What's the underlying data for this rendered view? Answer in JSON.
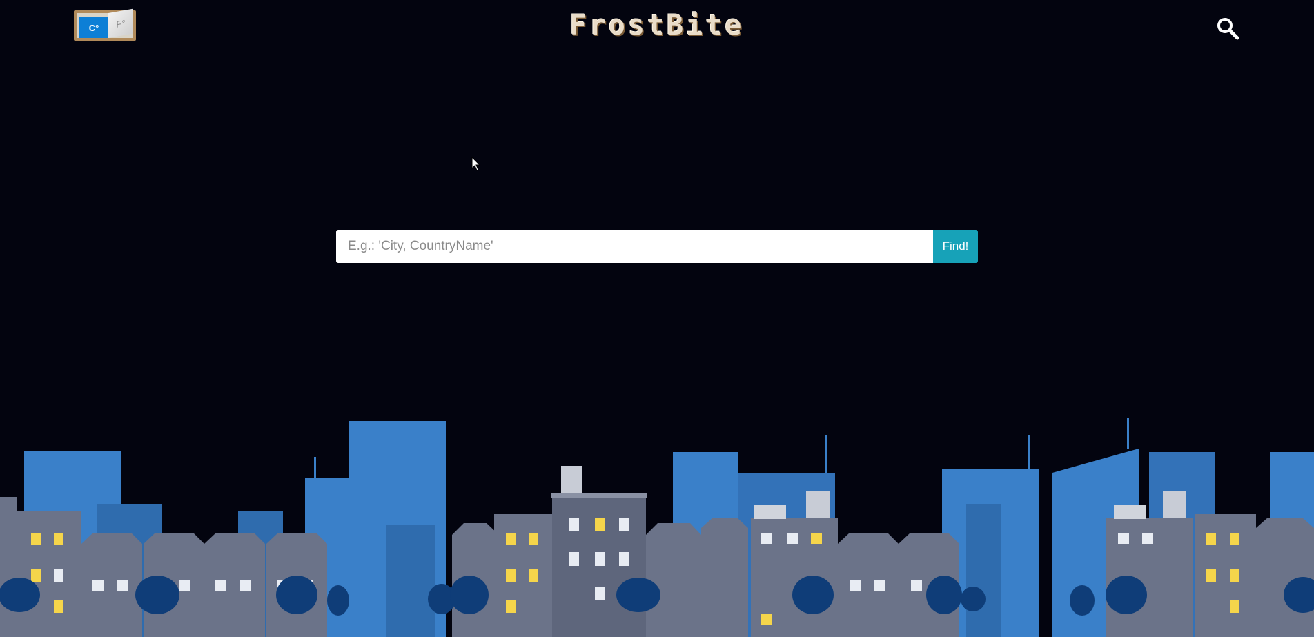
{
  "header": {
    "brand_title": "FrostBite",
    "unit_toggle": {
      "celsius_label": "C°",
      "fahrenheit_label": "F°",
      "selected": "celsius"
    },
    "search_icon": "search-icon"
  },
  "search": {
    "placeholder": "E.g.: 'City, CountryName'",
    "value": "",
    "button_label": "Find!"
  },
  "colors": {
    "background": "#03040f",
    "accent": "#17a2b8",
    "toggle_frame": "#b08a5a",
    "celsius_active": "#0d7fd6",
    "skyline_back": "#3a80c9",
    "buildings": "#6b7389",
    "trees": "#0f3d78",
    "window_lit": "#f5d54b"
  }
}
